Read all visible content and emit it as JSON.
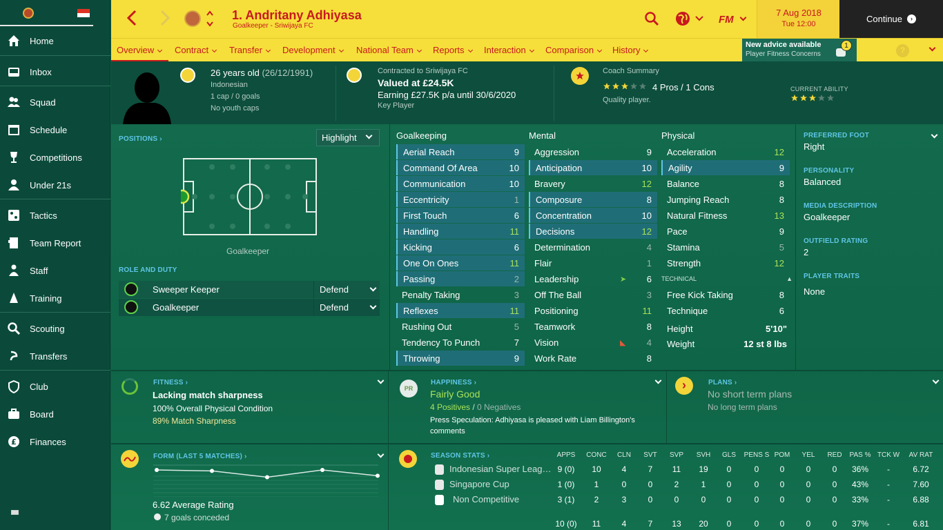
{
  "sidebar": {
    "items": [
      {
        "label": "Home",
        "icon": "home-icon"
      },
      {
        "label": "Inbox",
        "icon": "inbox-icon"
      },
      {
        "label": "Squad",
        "icon": "squad-icon"
      },
      {
        "label": "Schedule",
        "icon": "calendar-icon"
      },
      {
        "label": "Competitions",
        "icon": "trophy-icon"
      },
      {
        "label": "Under 21s",
        "icon": "u21-icon"
      },
      {
        "label": "Tactics",
        "icon": "tactics-icon"
      },
      {
        "label": "Team Report",
        "icon": "report-icon"
      },
      {
        "label": "Staff",
        "icon": "staff-icon"
      },
      {
        "label": "Training",
        "icon": "training-icon"
      },
      {
        "label": "Scouting",
        "icon": "search-icon"
      },
      {
        "label": "Transfers",
        "icon": "transfers-icon"
      },
      {
        "label": "Club",
        "icon": "club-icon"
      },
      {
        "label": "Board",
        "icon": "board-icon"
      },
      {
        "label": "Finances",
        "icon": "finances-icon"
      }
    ]
  },
  "header": {
    "title": "1. Andritany Adhiyasa",
    "subtitle": "Goalkeeper - Sriwijaya FC",
    "date": "7 Aug 2018",
    "time": "Tue 12:00",
    "continue_label": "Continue",
    "fm_label": "FM"
  },
  "nav": {
    "tabs": [
      "Overview",
      "Contract",
      "Transfer",
      "Development",
      "National Team",
      "Reports",
      "Interaction",
      "Comparison",
      "History"
    ],
    "advice_title": "New advice available",
    "advice_sub": "Player Fitness Concerns",
    "advice_count": "1"
  },
  "profile": {
    "age": "26 years old",
    "dob": "(26/12/1991)",
    "nationality": "Indonesian",
    "caps": "1 cap / 0 goals",
    "youth": "No youth caps",
    "contract_title": "Contracted to Sriwijaya FC",
    "value": "Valued at £24.5K",
    "earning": "Earning £27.5K p/a until 30/6/2020",
    "role": "Key Player",
    "coach_title": "Coach Summary",
    "pros_cons": "4 Pros / 1 Cons",
    "quality": "Quality player.",
    "ca_label": "CURRENT ABILITY",
    "coach_stars": 3,
    "ca_stars": 3
  },
  "positions": {
    "label": "POSITIONS",
    "highlight": "Highlight",
    "position_text": "Goalkeeper",
    "role_duty_label": "ROLE AND DUTY",
    "roles": [
      {
        "role": "Sweeper Keeper",
        "duty": "Defend"
      },
      {
        "role": "Goalkeeper",
        "duty": "Defend"
      }
    ]
  },
  "attributes": {
    "gk_title": "Goalkeeping",
    "mental_title": "Mental",
    "physical_title": "Physical",
    "technical_title": "TECHNICAL",
    "goalkeeping": [
      [
        "Aerial Reach",
        "9"
      ],
      [
        "Command Of Area",
        "10"
      ],
      [
        "Communication",
        "10"
      ],
      [
        "Eccentricity",
        "1"
      ],
      [
        "First Touch",
        "6"
      ],
      [
        "Handling",
        "11"
      ],
      [
        "Kicking",
        "6"
      ],
      [
        "One On Ones",
        "11"
      ],
      [
        "Passing",
        "2"
      ],
      [
        "Penalty Taking",
        "3"
      ],
      [
        "Reflexes",
        "11"
      ],
      [
        "Rushing Out",
        "5"
      ],
      [
        "Tendency To Punch",
        "7"
      ],
      [
        "Throwing",
        "9"
      ]
    ],
    "mental": [
      [
        "Aggression",
        "9"
      ],
      [
        "Anticipation",
        "10"
      ],
      [
        "Bravery",
        "12"
      ],
      [
        "Composure",
        "8"
      ],
      [
        "Concentration",
        "10"
      ],
      [
        "Decisions",
        "12"
      ],
      [
        "Determination",
        "4"
      ],
      [
        "Flair",
        "1"
      ],
      [
        "Leadership",
        "6"
      ],
      [
        "Off The Ball",
        "3"
      ],
      [
        "Positioning",
        "11"
      ],
      [
        "Teamwork",
        "8"
      ],
      [
        "Vision",
        "4"
      ],
      [
        "Work Rate",
        "8"
      ]
    ],
    "physical": [
      [
        "Acceleration",
        "12"
      ],
      [
        "Agility",
        "9"
      ],
      [
        "Balance",
        "8"
      ],
      [
        "Jumping Reach",
        "8"
      ],
      [
        "Natural Fitness",
        "13"
      ],
      [
        "Pace",
        "9"
      ],
      [
        "Stamina",
        "5"
      ],
      [
        "Strength",
        "12"
      ]
    ],
    "technical": [
      [
        "Free Kick Taking",
        "8"
      ],
      [
        "Technique",
        "6"
      ]
    ],
    "height_label": "Height",
    "height": "5'10\"",
    "weight_label": "Weight",
    "weight": "12 st 8 lbs"
  },
  "info": {
    "preferred_foot_label": "PREFERRED FOOT",
    "preferred_foot": "Right",
    "personality_label": "PERSONALITY",
    "personality": "Balanced",
    "media_label": "MEDIA DESCRIPTION",
    "media": "Goalkeeper",
    "outfield_label": "OUTFIELD RATING",
    "outfield": "2",
    "traits_label": "PLAYER TRAITS",
    "traits": "None"
  },
  "fitness": {
    "label": "FITNESS",
    "title": "Lacking match sharpness",
    "line1": "100% Overall Physical Condition",
    "line2": "89% Match Sharpness"
  },
  "happiness": {
    "label": "HAPPINESS",
    "badge": "PR",
    "title": "Fairly Good",
    "positives": "4 Positives",
    "negatives": "0 Negatives",
    "text": "Press Speculation: Adhiyasa is pleased with Liam Billington's comments"
  },
  "plans": {
    "label": "PLANS",
    "short": "No short term plans",
    "long": "No long term plans"
  },
  "form": {
    "label": "FORM (LAST 5 MATCHES)",
    "avg": "6.62 Average Rating",
    "goals": "7 goals conceded",
    "ratings": [
      6.7,
      6.68,
      6.55,
      6.7,
      6.58
    ]
  },
  "season": {
    "label": "SEASON STATS",
    "headers": [
      "APPS",
      "CONC",
      "CLN",
      "SVT",
      "SVP",
      "SVH",
      "GLS",
      "PENS S",
      "POM",
      "YEL",
      "RED",
      "PAS %",
      "TCK W",
      "AV RAT"
    ],
    "rows": [
      {
        "comp": "Indonesian Super Leag…",
        "vals": [
          "9 (0)",
          "10",
          "4",
          "7",
          "11",
          "19",
          "0",
          "0",
          "0",
          "0",
          "0",
          "36%",
          "-",
          "6.72"
        ]
      },
      {
        "comp": "Singapore Cup",
        "vals": [
          "1 (0)",
          "1",
          "0",
          "0",
          "2",
          "1",
          "0",
          "0",
          "0",
          "0",
          "0",
          "43%",
          "-",
          "7.60"
        ]
      },
      {
        "comp": "Non Competitive",
        "vals": [
          "3 (1)",
          "2",
          "3",
          "0",
          "0",
          "0",
          "0",
          "0",
          "0",
          "0",
          "0",
          "33%",
          "-",
          "6.88"
        ]
      }
    ],
    "totals": [
      "10 (0)",
      "11",
      "4",
      "7",
      "13",
      "20",
      "0",
      "0",
      "0",
      "0",
      "0",
      "37%",
      "-",
      "6.81"
    ]
  },
  "colors": {
    "accent": "#c8191f",
    "topbar": "#f6df3a",
    "sidebar": "#0b4a3a",
    "good": "#a9e25a",
    "label": "#5fc6e6"
  }
}
